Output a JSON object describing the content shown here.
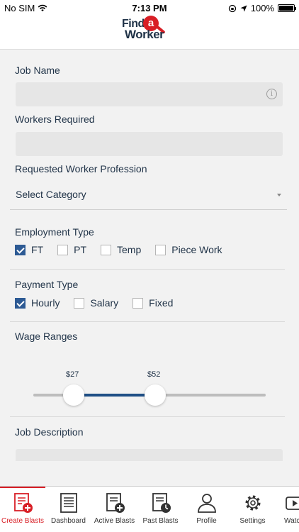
{
  "status_bar": {
    "carrier": "No SIM",
    "time": "7:13 PM",
    "battery": "100%"
  },
  "header": {
    "logo_find": "Find",
    "logo_a": "a",
    "logo_worker": "Worker"
  },
  "form": {
    "job_name_label": "Job Name",
    "job_name_value": "",
    "workers_required_label": "Workers Required",
    "workers_required_value": "",
    "profession_label": "Requested Worker Profession",
    "profession_value": "Select Category",
    "employment_type_label": "Employment Type",
    "employment_options": [
      {
        "label": "FT",
        "checked": true
      },
      {
        "label": "PT",
        "checked": false
      },
      {
        "label": "Temp",
        "checked": false
      },
      {
        "label": "Piece Work",
        "checked": false
      }
    ],
    "payment_type_label": "Payment Type",
    "payment_options": [
      {
        "label": "Hourly",
        "checked": true
      },
      {
        "label": "Salary",
        "checked": false
      },
      {
        "label": "Fixed",
        "checked": false
      }
    ],
    "wage_ranges_label": "Wage Ranges",
    "wage_min_label": "$27",
    "wage_max_label": "$52",
    "wage_min": 27,
    "wage_max": 52,
    "job_description_label": "Job Description"
  },
  "tabbar": {
    "items": [
      {
        "label": "Create Blasts",
        "icon": "create-blast-icon",
        "active": true
      },
      {
        "label": "Dashboard",
        "icon": "dashboard-icon",
        "active": false
      },
      {
        "label": "Active Blasts",
        "icon": "active-blasts-icon",
        "active": false
      },
      {
        "label": "Past Blasts",
        "icon": "past-blasts-icon",
        "active": false
      },
      {
        "label": "Profile",
        "icon": "profile-icon",
        "active": false
      },
      {
        "label": "Settings",
        "icon": "settings-icon",
        "active": false
      },
      {
        "label": "Watchlist",
        "icon": "watchlist-icon",
        "active": false
      }
    ]
  },
  "colors": {
    "accent_red": "#d81f26",
    "primary_blue": "#2d5a94",
    "text_dark": "#1f3247"
  }
}
